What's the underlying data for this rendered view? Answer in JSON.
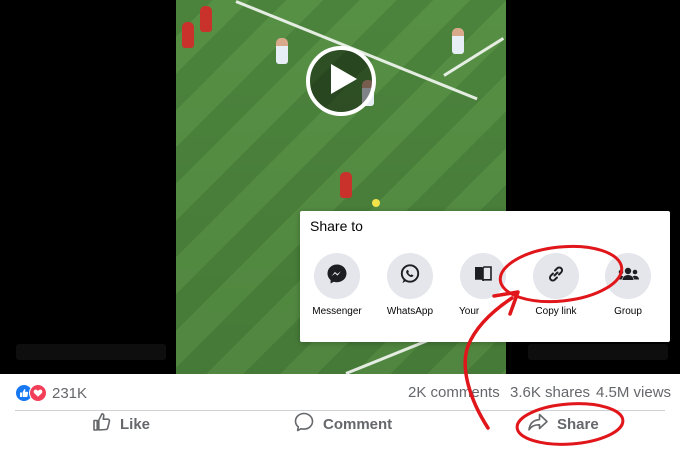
{
  "video": {
    "play_icon": "play-icon"
  },
  "share_panel": {
    "title": "Share to",
    "options": [
      {
        "label": "Messenger",
        "icon": "messenger-icon"
      },
      {
        "label": "WhatsApp",
        "icon": "whatsapp-icon"
      },
      {
        "label": "Your",
        "icon": "book-icon"
      },
      {
        "label": "Copy link",
        "icon": "link-icon"
      },
      {
        "label": "Group",
        "icon": "group-icon"
      }
    ]
  },
  "stats": {
    "reactions_count": "231K",
    "comments": "2K comments",
    "shares": "3.6K shares",
    "views": "4.5M views"
  },
  "actions": {
    "like": "Like",
    "comment": "Comment",
    "share": "Share"
  },
  "colors": {
    "like_blue": "#1877f2",
    "love_red": "#f33e58",
    "annotation_red": "#e0161b"
  }
}
